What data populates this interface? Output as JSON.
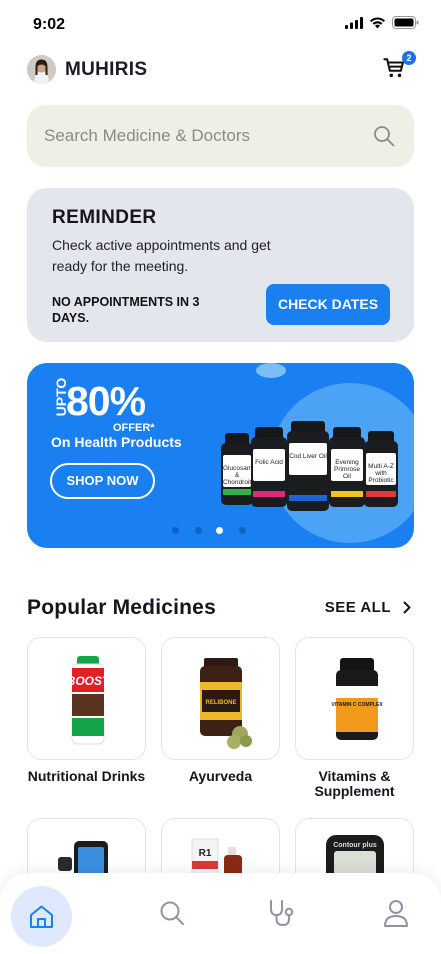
{
  "status_bar": {
    "time": "9:02"
  },
  "header": {
    "user_name": "MUHIRIS",
    "cart_count": "2"
  },
  "search": {
    "placeholder": "Search Medicine & Doctors"
  },
  "reminder": {
    "title": "REMINDER",
    "description": "Check active appointments and get ready for the meeting.",
    "note": "NO APPOINTMENTS IN 3 DAYS.",
    "button_label": "CHECK DATES"
  },
  "promo": {
    "upto": "UPTO",
    "percent": "80%",
    "offer": "OFFER*",
    "subtitle": "On Health Products",
    "button_label": "SHOP NOW",
    "carousel_active_index": 2,
    "bottles": [
      "Glucosamine & Chondroitin",
      "Folic Acid",
      "Cod Liver Oil",
      "Evening Primrose Oil",
      "Multi A-Z with Probiotic"
    ]
  },
  "popular": {
    "title": "Popular Medicines",
    "see_all": "SEE ALL",
    "categories": [
      {
        "label": "Nutritional Drinks",
        "product_text": "BOOST"
      },
      {
        "label": "Ayurveda",
        "product_text": "RELIBONE"
      },
      {
        "label": "Vitamins & Supplement",
        "product_text": "VITAMIN C COMPLEX"
      }
    ],
    "partial_row": [
      {
        "icon": "blood-pressure-monitor"
      },
      {
        "icon": "homeopathy-bottles",
        "product_text": "R1"
      },
      {
        "icon": "glucometer",
        "product_text": "Contour plus"
      }
    ]
  },
  "colors": {
    "accent": "#1a7ff0",
    "badge": "#1a73e8",
    "reminder_bg": "#e3e6ec",
    "search_bg": "#efefe5"
  },
  "bottom_nav": [
    "home-icon",
    "search-icon",
    "stethoscope-icon",
    "profile-icon"
  ]
}
